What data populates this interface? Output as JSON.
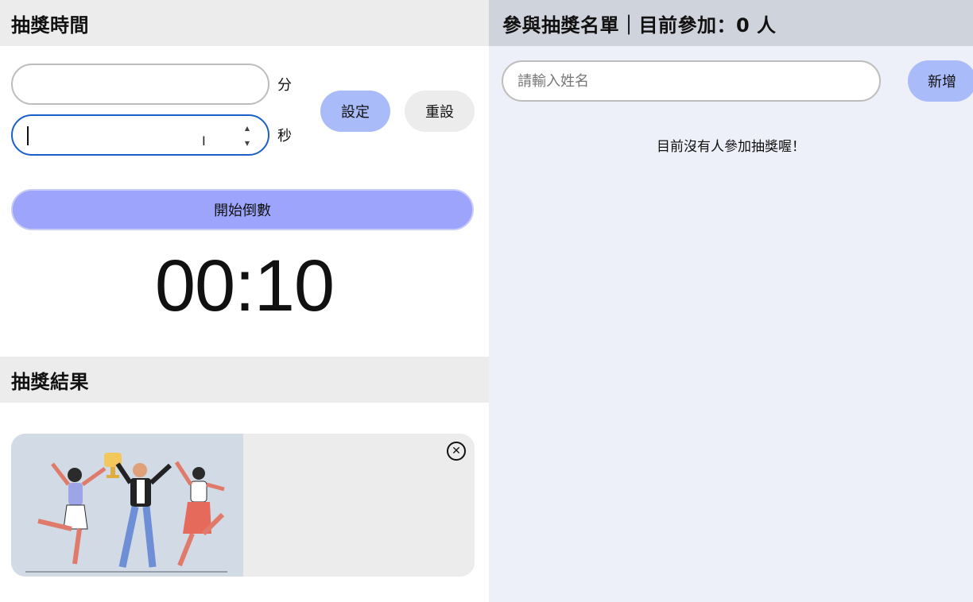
{
  "timer_panel": {
    "title": "抽獎時間",
    "minutes_value": "",
    "minutes_unit": "分",
    "seconds_value": "",
    "seconds_unit": "秒",
    "set_label": "設定",
    "reset_label": "重設",
    "start_label": "開始倒數",
    "display": "00:10"
  },
  "result_panel": {
    "title": "抽獎結果"
  },
  "participants_panel": {
    "title": "參與抽獎名單｜目前參加：0 人",
    "name_placeholder": "請輸入姓名",
    "add_label": "新增",
    "empty_message": "目前沒有人參加抽獎喔！"
  },
  "colors": {
    "primary_button": "#a9bbf9",
    "start_button": "#9da4fb",
    "focus_border": "#1a5fc9",
    "right_panel_bg": "#edf0f8",
    "header_bg": "#ececec"
  },
  "icons": {
    "close": "close-circle-icon",
    "spinner": "number-spinner-icon",
    "cursor": "text-cursor-icon"
  }
}
